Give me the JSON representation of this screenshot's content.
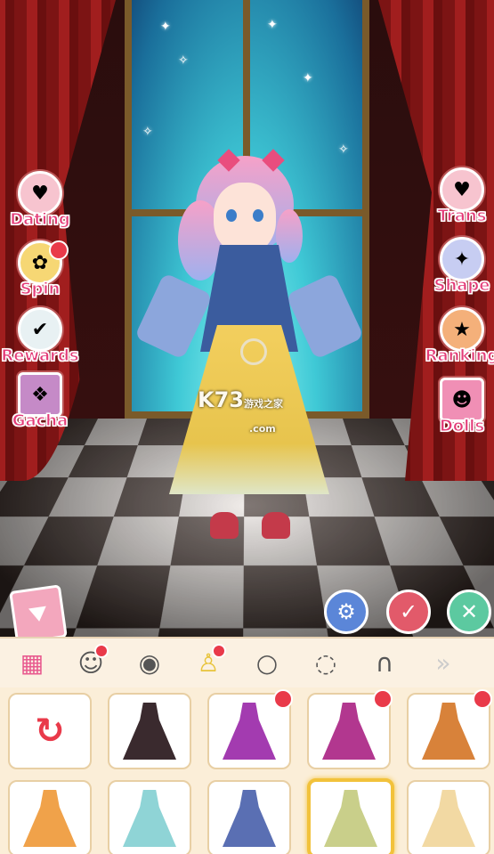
{
  "side_menu_left": [
    {
      "label": "Dating",
      "icon": "heart-girl-icon",
      "badge": false
    },
    {
      "label": "Spin",
      "icon": "spin-wheel-icon",
      "badge": true
    },
    {
      "label": "Rewards",
      "icon": "checklist-icon",
      "badge": false
    },
    {
      "label": "Gacha",
      "icon": "gacha-card-icon",
      "badge": false
    }
  ],
  "side_menu_right": [
    {
      "label": "Trans",
      "icon": "heart-wings-icon",
      "badge": false
    },
    {
      "label": "Shape",
      "icon": "outfit-icon",
      "badge": false
    },
    {
      "label": "Ranking",
      "icon": "trophy-icon",
      "badge": false
    },
    {
      "label": "Dolls",
      "icon": "doll-icon",
      "badge": false
    }
  ],
  "watermark": {
    "main": "K73",
    "sub": "游戏之家",
    "sub2": ".com"
  },
  "actions": {
    "settings_icon": "gear-icon",
    "confirm_icon": "check-icon",
    "cancel_icon": "close-icon"
  },
  "toolbar": [
    {
      "icon": "wardrobe-icon",
      "badge": false
    },
    {
      "icon": "face-icon",
      "badge": true
    },
    {
      "icon": "hair-icon",
      "badge": false
    },
    {
      "icon": "dress-icon",
      "badge": true
    },
    {
      "icon": "head-shape-icon",
      "badge": false
    },
    {
      "icon": "eyes-icon",
      "badge": false
    },
    {
      "icon": "headband-icon",
      "badge": false
    },
    {
      "icon": "more-arrows-icon",
      "badge": false
    }
  ],
  "items": [
    {
      "type": "reset",
      "badge": false,
      "selected": false,
      "color": "#e93a4a"
    },
    {
      "type": "gown",
      "badge": false,
      "selected": false,
      "color": "#3a2a2e"
    },
    {
      "type": "gown",
      "badge": true,
      "selected": false,
      "color": "#a33bb0"
    },
    {
      "type": "gown",
      "badge": true,
      "selected": false,
      "color": "#b2378f"
    },
    {
      "type": "gown",
      "badge": true,
      "selected": false,
      "color": "#d8823a"
    },
    {
      "type": "gown",
      "badge": false,
      "selected": false,
      "color": "#f0a24a"
    },
    {
      "type": "gown",
      "badge": false,
      "selected": false,
      "color": "#8fd4d6"
    },
    {
      "type": "gown",
      "badge": false,
      "selected": false,
      "color": "#5a6fb3"
    },
    {
      "type": "gown",
      "badge": false,
      "selected": true,
      "color": "#c9cf8a"
    },
    {
      "type": "gown",
      "badge": false,
      "selected": false,
      "color": "#f2d9a3"
    }
  ],
  "colors": {
    "label": "#e43b78",
    "badge": "#e93a4a",
    "confirm": "#e25a6a",
    "cancel": "#5cc9a0",
    "settings": "#5b86d8",
    "highlight": "#f2c23b"
  }
}
